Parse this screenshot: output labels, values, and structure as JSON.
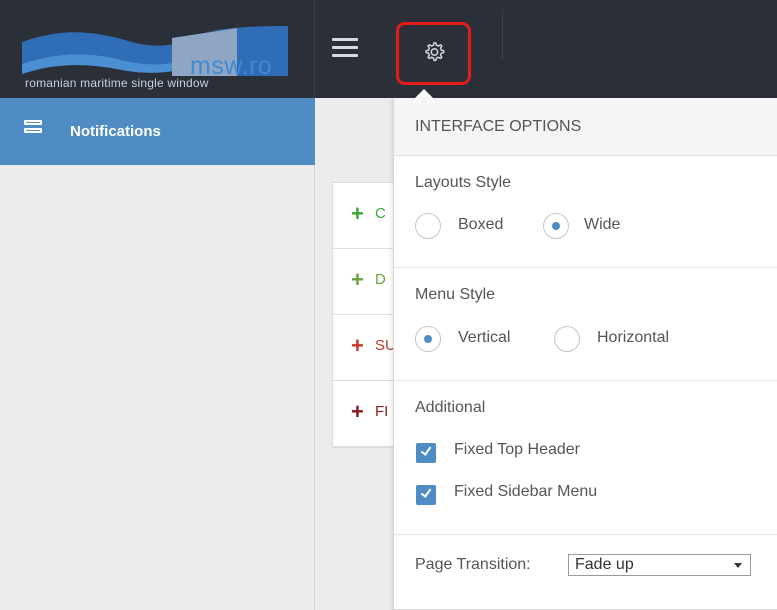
{
  "header": {
    "logo_brand": "msw.ro",
    "logo_tagline": "romanian maritime single window",
    "menu_icon": "hamburger-icon",
    "settings_icon": "gear-icon",
    "highlight_color": "#e31b1b"
  },
  "sidebar": {
    "items": [
      {
        "label": "Notifications",
        "icon": "list-icon",
        "active": true
      }
    ],
    "active_color": "#4f8cc4"
  },
  "main": {
    "cards": [
      {
        "text": "C",
        "color": "#3aa63a"
      },
      {
        "text": "D",
        "color": "#6ba23a"
      },
      {
        "text": "SU",
        "color": "#c0392b"
      },
      {
        "text": "FI",
        "color": "#8b1a1a"
      }
    ]
  },
  "panel": {
    "title": "INTERFACE OPTIONS",
    "layouts": {
      "title": "Layouts Style",
      "options": [
        "Boxed",
        "Wide"
      ],
      "selected": "Wide"
    },
    "menu": {
      "title": "Menu Style",
      "options": [
        "Vertical",
        "Horizontal"
      ],
      "selected": "Vertical"
    },
    "additional": {
      "title": "Additional",
      "checks": [
        {
          "label": "Fixed Top Header",
          "checked": true
        },
        {
          "label": "Fixed Sidebar Menu",
          "checked": true
        }
      ]
    },
    "transition": {
      "label": "Page Transition:",
      "value": "Fade up"
    }
  }
}
